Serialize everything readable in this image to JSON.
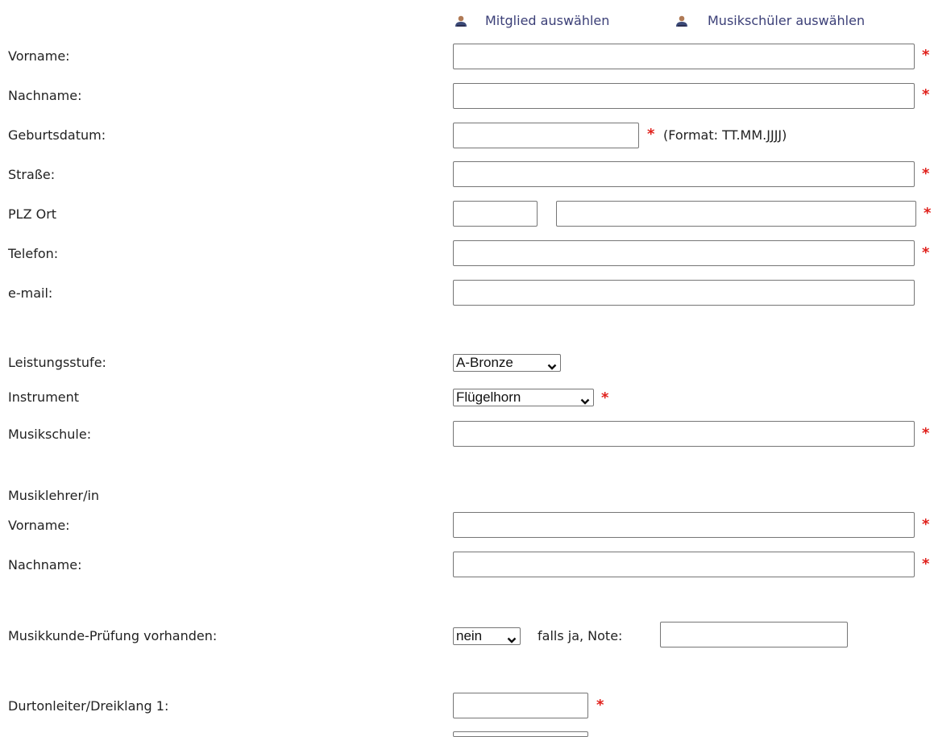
{
  "top_links": {
    "member_select": "Mitglied auswählen",
    "student_select": "Musikschüler auswählen",
    "icon": "user-icon"
  },
  "required_marker": "*",
  "fields": {
    "vorname": {
      "label": "Vorname:",
      "value": ""
    },
    "nachname": {
      "label": "Nachname:",
      "value": ""
    },
    "geburtsdatum": {
      "label": "Geburtsdatum:",
      "value": "",
      "hint": "(Format: TT.MM.JJJJ)"
    },
    "strasse": {
      "label": "Straße:",
      "value": ""
    },
    "plz_ort": {
      "label": "PLZ Ort",
      "plz": "",
      "ort": ""
    },
    "telefon": {
      "label": "Telefon:",
      "value": ""
    },
    "email": {
      "label": "e-mail:",
      "value": ""
    },
    "leistungsstufe": {
      "label": "Leistungsstufe:",
      "selected": "A-Bronze"
    },
    "instrument": {
      "label": "Instrument",
      "selected": "Flügelhorn"
    },
    "musikschule": {
      "label": "Musikschule:",
      "value": ""
    },
    "lehrer_heading": "Musiklehrer/in",
    "lehrer_vorname": {
      "label": "Vorname:",
      "value": ""
    },
    "lehrer_nachname": {
      "label": "Nachname:",
      "value": ""
    },
    "musikkunde": {
      "label": "Musikkunde-Prüfung vorhanden:",
      "selected": "nein",
      "note_label": "falls ja, Note:",
      "note_value": ""
    },
    "durtonleiter1": {
      "label": "Durtonleiter/Dreiklang 1:",
      "value": ""
    }
  },
  "colors": {
    "required": "#e0201b",
    "link": "#3b3f77",
    "border": "#767676"
  }
}
